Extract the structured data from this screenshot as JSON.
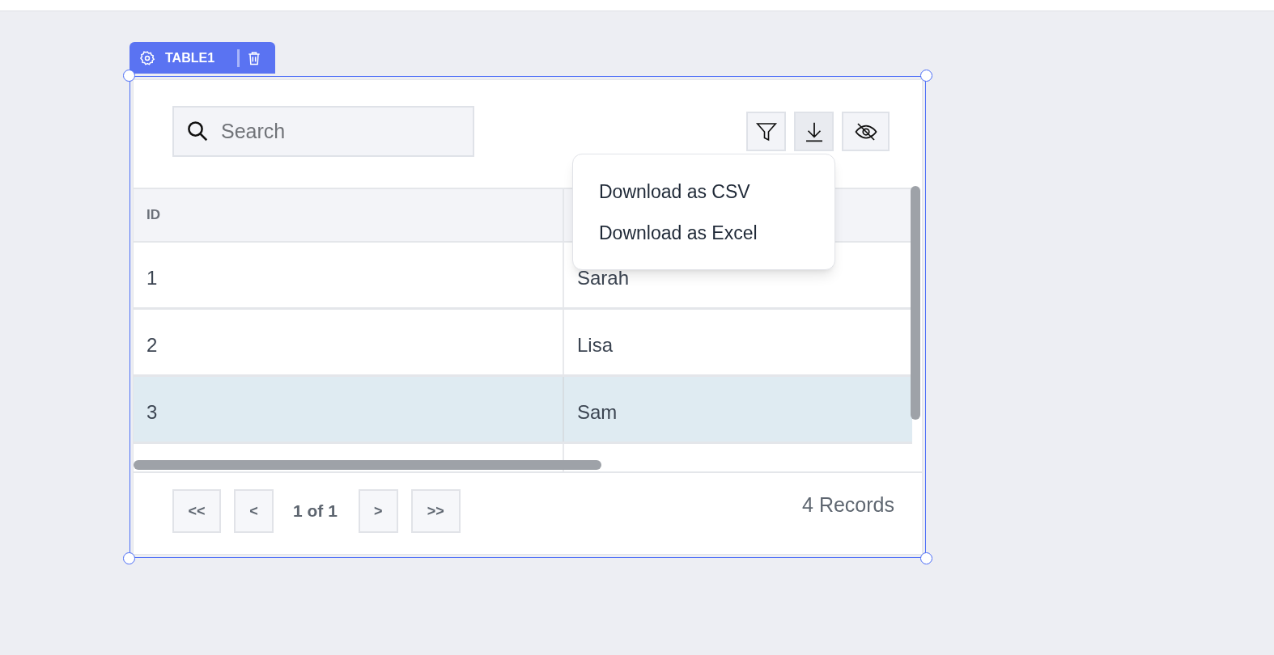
{
  "widget": {
    "label": "TABLE1"
  },
  "search": {
    "placeholder": "Search"
  },
  "download_menu": {
    "expanded": true,
    "items": [
      "Download as CSV",
      "Download as Excel"
    ]
  },
  "table": {
    "columns": [
      "ID"
    ],
    "rows": [
      {
        "cells": [
          "1",
          "Sarah"
        ],
        "selected": false
      },
      {
        "cells": [
          "2",
          "Lisa"
        ],
        "selected": false
      },
      {
        "cells": [
          "3",
          "Sam"
        ],
        "selected": true
      }
    ]
  },
  "pagination": {
    "first": "<<",
    "previous": "<",
    "page": "1 of 1",
    "next": ">",
    "last": ">>"
  },
  "record_count": "4 Records"
}
